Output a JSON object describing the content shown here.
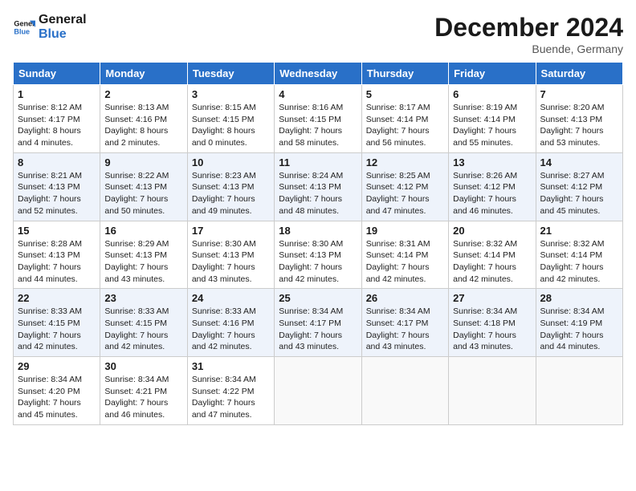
{
  "header": {
    "logo_line1": "General",
    "logo_line2": "Blue",
    "month_title": "December 2024",
    "location": "Buende, Germany"
  },
  "weekdays": [
    "Sunday",
    "Monday",
    "Tuesday",
    "Wednesday",
    "Thursday",
    "Friday",
    "Saturday"
  ],
  "weeks": [
    [
      {
        "day": "1",
        "sunrise": "Sunrise: 8:12 AM",
        "sunset": "Sunset: 4:17 PM",
        "daylight": "Daylight: 8 hours and 4 minutes."
      },
      {
        "day": "2",
        "sunrise": "Sunrise: 8:13 AM",
        "sunset": "Sunset: 4:16 PM",
        "daylight": "Daylight: 8 hours and 2 minutes."
      },
      {
        "day": "3",
        "sunrise": "Sunrise: 8:15 AM",
        "sunset": "Sunset: 4:15 PM",
        "daylight": "Daylight: 8 hours and 0 minutes."
      },
      {
        "day": "4",
        "sunrise": "Sunrise: 8:16 AM",
        "sunset": "Sunset: 4:15 PM",
        "daylight": "Daylight: 7 hours and 58 minutes."
      },
      {
        "day": "5",
        "sunrise": "Sunrise: 8:17 AM",
        "sunset": "Sunset: 4:14 PM",
        "daylight": "Daylight: 7 hours and 56 minutes."
      },
      {
        "day": "6",
        "sunrise": "Sunrise: 8:19 AM",
        "sunset": "Sunset: 4:14 PM",
        "daylight": "Daylight: 7 hours and 55 minutes."
      },
      {
        "day": "7",
        "sunrise": "Sunrise: 8:20 AM",
        "sunset": "Sunset: 4:13 PM",
        "daylight": "Daylight: 7 hours and 53 minutes."
      }
    ],
    [
      {
        "day": "8",
        "sunrise": "Sunrise: 8:21 AM",
        "sunset": "Sunset: 4:13 PM",
        "daylight": "Daylight: 7 hours and 52 minutes."
      },
      {
        "day": "9",
        "sunrise": "Sunrise: 8:22 AM",
        "sunset": "Sunset: 4:13 PM",
        "daylight": "Daylight: 7 hours and 50 minutes."
      },
      {
        "day": "10",
        "sunrise": "Sunrise: 8:23 AM",
        "sunset": "Sunset: 4:13 PM",
        "daylight": "Daylight: 7 hours and 49 minutes."
      },
      {
        "day": "11",
        "sunrise": "Sunrise: 8:24 AM",
        "sunset": "Sunset: 4:13 PM",
        "daylight": "Daylight: 7 hours and 48 minutes."
      },
      {
        "day": "12",
        "sunrise": "Sunrise: 8:25 AM",
        "sunset": "Sunset: 4:12 PM",
        "daylight": "Daylight: 7 hours and 47 minutes."
      },
      {
        "day": "13",
        "sunrise": "Sunrise: 8:26 AM",
        "sunset": "Sunset: 4:12 PM",
        "daylight": "Daylight: 7 hours and 46 minutes."
      },
      {
        "day": "14",
        "sunrise": "Sunrise: 8:27 AM",
        "sunset": "Sunset: 4:12 PM",
        "daylight": "Daylight: 7 hours and 45 minutes."
      }
    ],
    [
      {
        "day": "15",
        "sunrise": "Sunrise: 8:28 AM",
        "sunset": "Sunset: 4:13 PM",
        "daylight": "Daylight: 7 hours and 44 minutes."
      },
      {
        "day": "16",
        "sunrise": "Sunrise: 8:29 AM",
        "sunset": "Sunset: 4:13 PM",
        "daylight": "Daylight: 7 hours and 43 minutes."
      },
      {
        "day": "17",
        "sunrise": "Sunrise: 8:30 AM",
        "sunset": "Sunset: 4:13 PM",
        "daylight": "Daylight: 7 hours and 43 minutes."
      },
      {
        "day": "18",
        "sunrise": "Sunrise: 8:30 AM",
        "sunset": "Sunset: 4:13 PM",
        "daylight": "Daylight: 7 hours and 42 minutes."
      },
      {
        "day": "19",
        "sunrise": "Sunrise: 8:31 AM",
        "sunset": "Sunset: 4:14 PM",
        "daylight": "Daylight: 7 hours and 42 minutes."
      },
      {
        "day": "20",
        "sunrise": "Sunrise: 8:32 AM",
        "sunset": "Sunset: 4:14 PM",
        "daylight": "Daylight: 7 hours and 42 minutes."
      },
      {
        "day": "21",
        "sunrise": "Sunrise: 8:32 AM",
        "sunset": "Sunset: 4:14 PM",
        "daylight": "Daylight: 7 hours and 42 minutes."
      }
    ],
    [
      {
        "day": "22",
        "sunrise": "Sunrise: 8:33 AM",
        "sunset": "Sunset: 4:15 PM",
        "daylight": "Daylight: 7 hours and 42 minutes."
      },
      {
        "day": "23",
        "sunrise": "Sunrise: 8:33 AM",
        "sunset": "Sunset: 4:15 PM",
        "daylight": "Daylight: 7 hours and 42 minutes."
      },
      {
        "day": "24",
        "sunrise": "Sunrise: 8:33 AM",
        "sunset": "Sunset: 4:16 PM",
        "daylight": "Daylight: 7 hours and 42 minutes."
      },
      {
        "day": "25",
        "sunrise": "Sunrise: 8:34 AM",
        "sunset": "Sunset: 4:17 PM",
        "daylight": "Daylight: 7 hours and 43 minutes."
      },
      {
        "day": "26",
        "sunrise": "Sunrise: 8:34 AM",
        "sunset": "Sunset: 4:17 PM",
        "daylight": "Daylight: 7 hours and 43 minutes."
      },
      {
        "day": "27",
        "sunrise": "Sunrise: 8:34 AM",
        "sunset": "Sunset: 4:18 PM",
        "daylight": "Daylight: 7 hours and 43 minutes."
      },
      {
        "day": "28",
        "sunrise": "Sunrise: 8:34 AM",
        "sunset": "Sunset: 4:19 PM",
        "daylight": "Daylight: 7 hours and 44 minutes."
      }
    ],
    [
      {
        "day": "29",
        "sunrise": "Sunrise: 8:34 AM",
        "sunset": "Sunset: 4:20 PM",
        "daylight": "Daylight: 7 hours and 45 minutes."
      },
      {
        "day": "30",
        "sunrise": "Sunrise: 8:34 AM",
        "sunset": "Sunset: 4:21 PM",
        "daylight": "Daylight: 7 hours and 46 minutes."
      },
      {
        "day": "31",
        "sunrise": "Sunrise: 8:34 AM",
        "sunset": "Sunset: 4:22 PM",
        "daylight": "Daylight: 7 hours and 47 minutes."
      },
      null,
      null,
      null,
      null
    ]
  ]
}
